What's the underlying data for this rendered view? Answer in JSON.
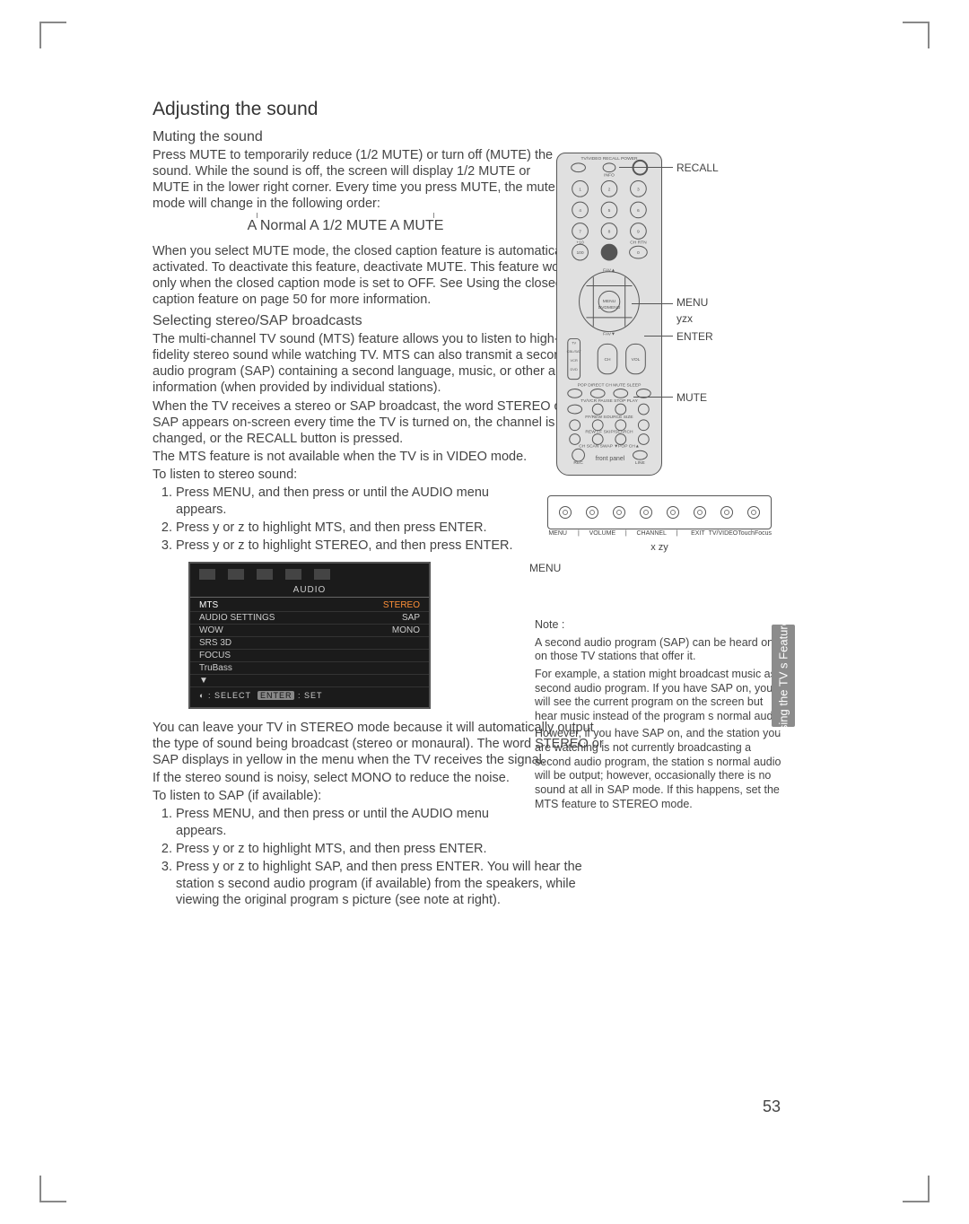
{
  "title": "Adjusting the sound",
  "sec1": {
    "heading": "Muting the sound",
    "p1": "Press MUTE to temporarily reduce (1/2 MUTE) or turn off (MUTE) the sound. While the sound is off, the screen will display  1/2 MUTE  or  MUTE  in the lower right corner. Every time you press MUTE, the mute mode will change in the following order:",
    "flow": "A Normal A 1/2 MUTE  A MUTE",
    "p2": "When you select  MUTE  mode, the closed caption feature is automatically activated. To deactivate this feature, deactivate MUTE. This feature works only when the closed caption mode is set to OFF. See  Using the closed caption feature  on page 50 for more information."
  },
  "sec2": {
    "heading": "Selecting stereo/SAP broadcasts",
    "p1": "The multi-channel TV sound (MTS) feature allows you to listen to high-fidelity stereo sound while watching TV. MTS can also transmit a second audio program (SAP) containing a second language, music, or other audio information (when provided by individual stations).",
    "p2": "When the TV receives a stereo or SAP broadcast, the word STEREO or SAP appears on-screen every time the TV is turned on, the channel is changed, or the RECALL button is pressed.",
    "p3": "The MTS feature is not available when the TV is in VIDEO mode.",
    "stereo_lead": "To listen to stereo sound:",
    "ol1": [
      "Press MENU, and then press or     until the AUDIO menu appears.",
      "Press y  or z  to highlight MTS, and then press ENTER.",
      "Press y  or z  to highlight STEREO, and then press ENTER."
    ],
    "after_osd_p1": "You can leave your TV in STEREO mode because it will automatically output the type of sound being broadcast (stereo or monaural). The word  STEREO  or  SAP  displays in yellow in the menu when the TV receives the signal.",
    "after_osd_p2": "If the stereo sound is noisy, select MONO to reduce the noise.",
    "sap_lead": "To listen to SAP (if available):",
    "ol2": [
      "Press MENU, and then press or     until the AUDIO menu appears.",
      "Press y  or z  to highlight MTS, and then press ENTER.",
      "Press y  or z  to highlight SAP, and then press ENTER. You will hear the station s second audio program (if available) from the speakers, while viewing the original program s picture (see note at right)."
    ]
  },
  "osd": {
    "title": "AUDIO",
    "rows": [
      {
        "k": "MTS",
        "v": "STEREO"
      },
      {
        "k": "AUDIO  SETTINGS",
        "v": "SAP"
      },
      {
        "k": "WOW",
        "v": "MONO"
      },
      {
        "k": "  SRS 3D",
        "v": ""
      },
      {
        "k": "  FOCUS",
        "v": ""
      },
      {
        "k": "  TruBass",
        "v": ""
      }
    ],
    "foot_select": ": SELECT",
    "foot_badge": "ENTER",
    "foot_set": ": SET"
  },
  "remote_labels": {
    "recall": "RECALL",
    "menu": "MENU",
    "arrows": "yzx",
    "enter": "ENTER",
    "mute": "MUTE"
  },
  "remote_tiny": {
    "row_top": "TV/VIDEO  RECALL  POWER",
    "info": "INFO",
    "ch_rtn": "CH RTN",
    "fav_up": "FAV▲",
    "menu": "MENU",
    "dvdmenu": "DVDMENU",
    "fav_dn": "FAV▼",
    "left_col": "TV\nCBL/SAT\nVCR\nDVD",
    "ch": "CH",
    "vol": "VOL",
    "row_a": "POP DIRECT CH  MUTE  SLEEP",
    "row_b": "TV/VCR  PAUSE  STOP  PLAY",
    "row_c": "FF/REW  SOURCE  SIZE",
    "row_d": "REW    FF    SKIP/SEARCH",
    "row_e": "CH SCAN  SWAP   ▼POP CH▲",
    "row_f": "REC              LINE",
    "front": "front panel"
  },
  "front_panel": {
    "labels": [
      "MENU",
      "VOLUME",
      "CHANNEL",
      "EXIT",
      "TV/VIDEO",
      "TouchFocus"
    ],
    "arrows": "x  zy",
    "menu": "MENU"
  },
  "note": {
    "head": "Note :",
    "p1": "A second audio program (SAP) can be heard only on those TV stations that offer it.",
    "p2": "For example, a station might broadcast music as a second audio program. If you have SAP on, you will see the current program on the screen but hear music instead of the program s normal audio.",
    "p3": "However, if you have SAP on, and the station you are watching is not currently broadcasting a second audio program, the station s normal audio will be output; however, occasionally there is no sound at all in SAP mode. If this happens, set the MTS feature to STEREO mode."
  },
  "sidetab": "Using the TV s Features",
  "pagenum": "53"
}
